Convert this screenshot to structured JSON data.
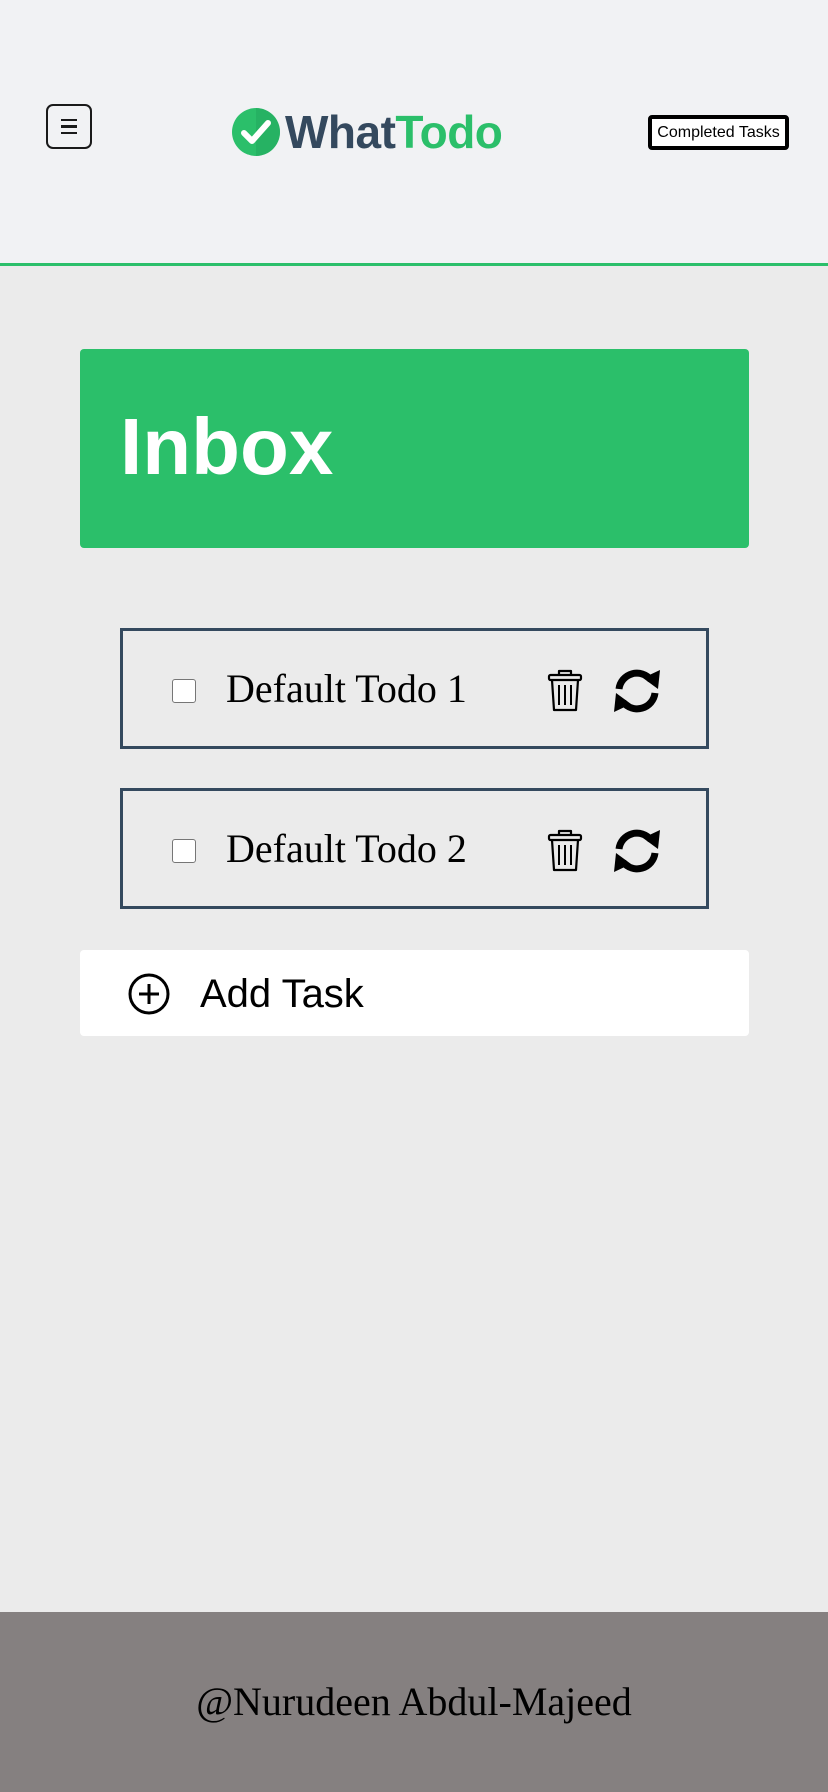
{
  "header": {
    "logo_what": "What",
    "logo_todo": "Todo",
    "completed_button": "Completed Tasks"
  },
  "inbox": {
    "title": "Inbox"
  },
  "todos": [
    {
      "text": "Default Todo 1",
      "checked": false
    },
    {
      "text": "Default Todo 2",
      "checked": false
    }
  ],
  "add_task": {
    "label": "Add Task"
  },
  "footer": {
    "text": "@Nurudeen Abdul-Majeed"
  },
  "icons": {
    "menu": "menu-icon",
    "logo": "checkmark-circle-icon",
    "trash": "trash-icon",
    "refresh": "refresh-icon",
    "add": "plus-circle-icon"
  },
  "colors": {
    "brand_green": "#2bbf6a",
    "brand_navy": "#34495e",
    "header_bg": "#f1f2f4",
    "page_bg": "#ebebeb",
    "footer_bg": "#858080"
  }
}
